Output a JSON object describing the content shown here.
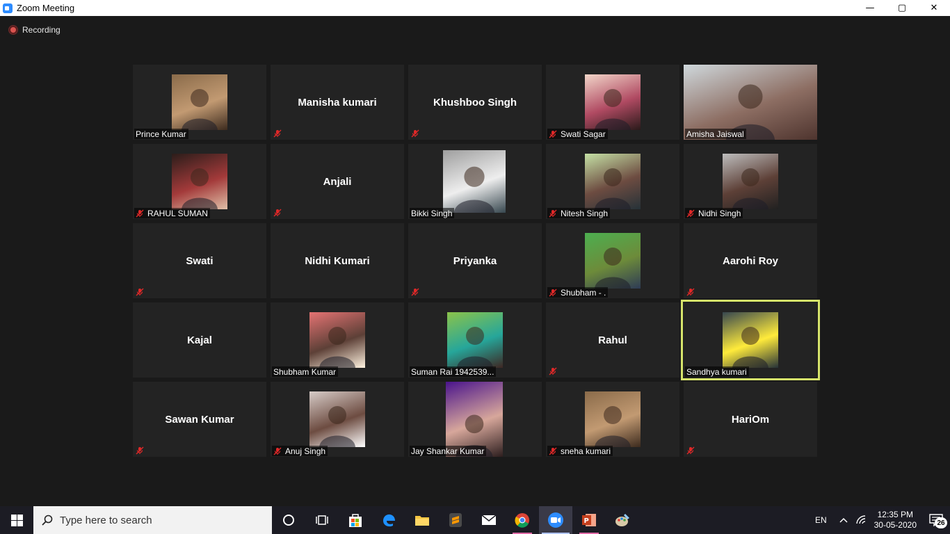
{
  "window": {
    "title": "Zoom Meeting",
    "minimize": "—",
    "maximize": "▢",
    "close": "✕"
  },
  "recording": {
    "label": "Recording"
  },
  "participants": [
    {
      "name": "Prince Kumar",
      "video": true,
      "muted": false
    },
    {
      "name": "Manisha kumari",
      "video": false,
      "muted": true
    },
    {
      "name": "Khushboo Singh",
      "video": false,
      "muted": true
    },
    {
      "name": "Swati Sagar",
      "video": true,
      "muted": true
    },
    {
      "name": "Amisha Jaiswal",
      "video": true,
      "muted": false
    },
    {
      "name": "RAHUL SUMAN",
      "video": true,
      "muted": true
    },
    {
      "name": "Anjali",
      "video": false,
      "muted": true
    },
    {
      "name": "Bikki Singh",
      "video": true,
      "muted": false
    },
    {
      "name": "Nitesh Singh",
      "video": true,
      "muted": true
    },
    {
      "name": "Nidhi Singh",
      "video": true,
      "muted": true
    },
    {
      "name": "Swati",
      "video": false,
      "muted": true
    },
    {
      "name": "Nidhi Kumari",
      "video": false,
      "muted": false
    },
    {
      "name": "Priyanka",
      "video": false,
      "muted": true
    },
    {
      "name": "Shubham - .",
      "video": true,
      "muted": true
    },
    {
      "name": "Aarohi Roy",
      "video": false,
      "muted": true
    },
    {
      "name": "Kajal",
      "video": false,
      "muted": false
    },
    {
      "name": "Shubham Kumar",
      "video": true,
      "muted": false
    },
    {
      "name": "Suman Rai 1942539...",
      "video": true,
      "muted": false
    },
    {
      "name": "Rahul",
      "video": false,
      "muted": true
    },
    {
      "name": "Sandhya kumari",
      "video": true,
      "muted": false,
      "active_speaker": true
    },
    {
      "name": "Sawan Kumar",
      "video": false,
      "muted": true
    },
    {
      "name": "Anuj Singh",
      "video": true,
      "muted": true
    },
    {
      "name": "Jay Shankar Kumar",
      "video": true,
      "muted": false
    },
    {
      "name": "sneha kumari",
      "video": true,
      "muted": true
    },
    {
      "name": "HariOm",
      "video": false,
      "muted": true
    }
  ],
  "taskbar": {
    "search_placeholder": "Type here to search",
    "language": "EN",
    "time": "12:35 PM",
    "date": "30-05-2020",
    "notification_count": "26"
  },
  "colors": {
    "active_speaker_border": "#d6e36b",
    "mute_icon": "#e02828",
    "taskbar_bg": "#1c1c24"
  }
}
